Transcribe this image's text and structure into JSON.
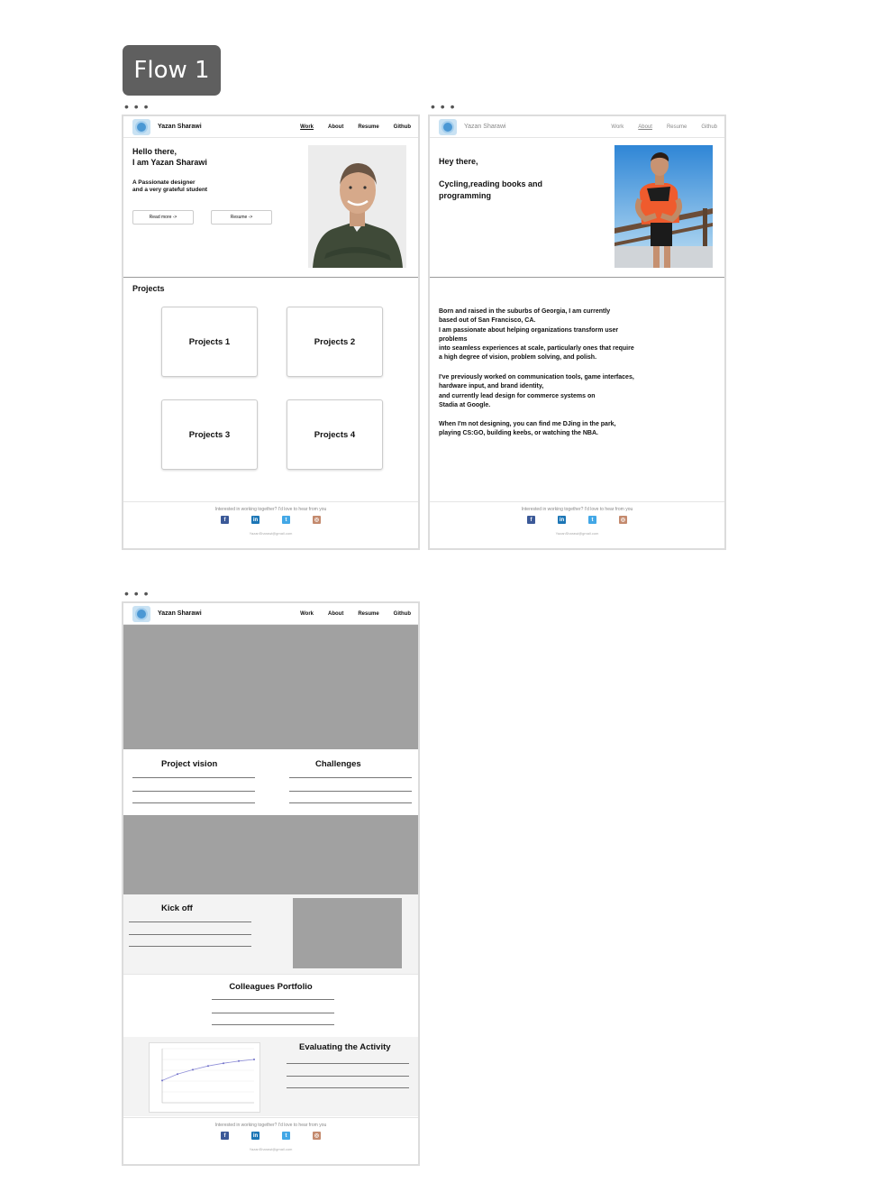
{
  "flow_label": "Flow 1",
  "frame_dots": "• • •",
  "nav": {
    "brand": "Yazan Sharawi",
    "links": [
      "Work",
      "About",
      "Resume",
      "Github"
    ]
  },
  "home": {
    "greeting_line1": "Hello there,",
    "greeting_line2": "I am Yazan Sharawi",
    "tagline_line1": "A Passionate designer",
    "tagline_line2": "and a very grateful student",
    "read_more_button": "Read more ->",
    "resume_button": "Resume ->",
    "projects_heading": "Projects",
    "projects": [
      "Projects 1",
      "Projects 2",
      "Projects 3",
      "Projects 4"
    ]
  },
  "about": {
    "greeting": "Hey there,",
    "hobbies_line1": "Cycling,reading books and",
    "hobbies_line2": "programming",
    "bio_paragraph1": [
      "Born and raised in the suburbs of Georgia, I am currently",
      "based out of San Francisco, CA.",
      "I am passionate about helping organizations transform user",
      "problems",
      "into seamless experiences at scale, particularly ones that require",
      "a high degree of vision, problem solving, and polish."
    ],
    "bio_paragraph2": [
      "I've previously worked on communication tools, game interfaces,",
      "hardware input, and brand identity,",
      "and currently lead design for commerce systems on",
      "Stadia at Google."
    ],
    "bio_paragraph3": [
      "When I'm not designing, you can find me DJing in the park,",
      "playing CS:GO, building keebs, or watching the NBA."
    ]
  },
  "project_page": {
    "project_vision": "Project vision",
    "challenges": "Challenges",
    "kick_off": "Kick off",
    "colleagues_portfolio": "Colleagues Portfolio",
    "evaluating_activity": "Evaluating the Activity"
  },
  "footer": {
    "text": "Interested in working together? I'd love to hear from you",
    "email": "YazanSharawi@gmail.com",
    "icons": [
      "facebook-icon",
      "linkedin-icon",
      "twitter-icon",
      "instagram-icon"
    ]
  },
  "chart_data": {
    "type": "line",
    "x": [
      1,
      2,
      3,
      4,
      5,
      6,
      7
    ],
    "series": [
      {
        "values": [
          4.1,
          5.3,
          6.1,
          6.8,
          7.3,
          7.7,
          8.0
        ]
      }
    ],
    "ylim": [
      0,
      10
    ],
    "grid": true
  },
  "colors": {
    "flow_label_bg": "#5f5f5f",
    "placeholder_gray": "#a1a1a1",
    "facebook": "#3b5998",
    "linkedin": "#1c76b6",
    "twitter": "#42a7e6",
    "instagram": "#c48a6e"
  }
}
